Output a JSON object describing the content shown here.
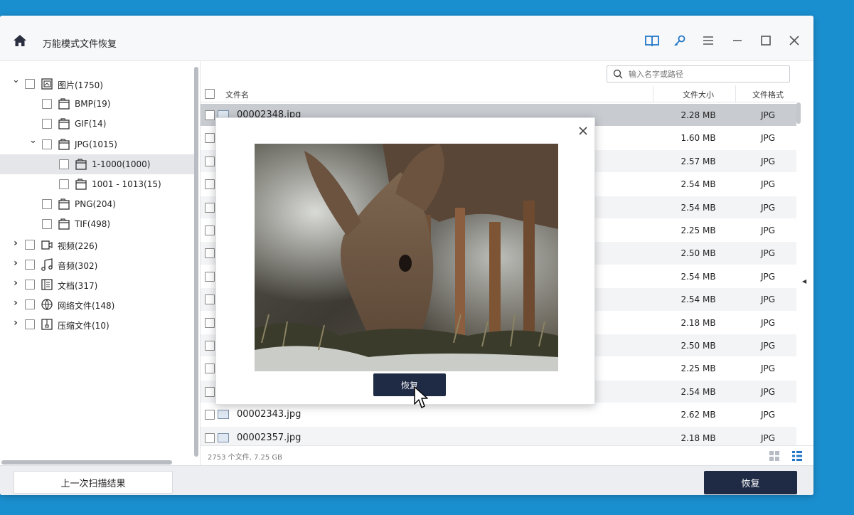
{
  "window": {
    "title": "万能模式文件恢复"
  },
  "search": {
    "placeholder": "输入名字或路径"
  },
  "tree": [
    {
      "label": "图片(1750)",
      "level": 0,
      "arrow": "down",
      "icon": "image-folder-icon"
    },
    {
      "label": "BMP(19)",
      "level": 1,
      "arrow": "",
      "icon": "folder-icon"
    },
    {
      "label": "GIF(14)",
      "level": 1,
      "arrow": "",
      "icon": "folder-icon"
    },
    {
      "label": "JPG(1015)",
      "level": 1,
      "arrow": "down",
      "icon": "folder-icon"
    },
    {
      "label": "1-1000(1000)",
      "level": 2,
      "arrow": "",
      "icon": "folder-icon",
      "selected": true
    },
    {
      "label": "1001 -  1013(15)",
      "level": 2,
      "arrow": "",
      "icon": "folder-icon"
    },
    {
      "label": "PNG(204)",
      "level": 1,
      "arrow": "",
      "icon": "folder-icon"
    },
    {
      "label": "TIF(498)",
      "level": 1,
      "arrow": "",
      "icon": "folder-icon"
    },
    {
      "label": "视频(226)",
      "level": 0,
      "arrow": "right",
      "icon": "video-icon"
    },
    {
      "label": "音频(302)",
      "level": 0,
      "arrow": "right",
      "icon": "music-icon"
    },
    {
      "label": "文档(317)",
      "level": 0,
      "arrow": "right",
      "icon": "document-icon"
    },
    {
      "label": "网络文件(148)",
      "level": 0,
      "arrow": "right",
      "icon": "globe-icon"
    },
    {
      "label": "压缩文件(10)",
      "level": 0,
      "arrow": "right",
      "icon": "archive-icon"
    }
  ],
  "table": {
    "columns": {
      "name": "文件名",
      "size": "文件大小",
      "type": "文件格式"
    },
    "rows": [
      {
        "name": "00002348.jpg",
        "size": "2.28 MB",
        "type": "JPG",
        "selected": true
      },
      {
        "name": "",
        "size": "1.60 MB",
        "type": "JPG"
      },
      {
        "name": "",
        "size": "2.57 MB",
        "type": "JPG"
      },
      {
        "name": "",
        "size": "2.54 MB",
        "type": "JPG"
      },
      {
        "name": "",
        "size": "2.54 MB",
        "type": "JPG"
      },
      {
        "name": "",
        "size": "2.25 MB",
        "type": "JPG"
      },
      {
        "name": "",
        "size": "2.50 MB",
        "type": "JPG"
      },
      {
        "name": "",
        "size": "2.54 MB",
        "type": "JPG"
      },
      {
        "name": "",
        "size": "2.54 MB",
        "type": "JPG"
      },
      {
        "name": "",
        "size": "2.18 MB",
        "type": "JPG"
      },
      {
        "name": "",
        "size": "2.50 MB",
        "type": "JPG"
      },
      {
        "name": "",
        "size": "2.25 MB",
        "type": "JPG"
      },
      {
        "name": "",
        "size": "2.54 MB",
        "type": "JPG"
      },
      {
        "name": "00002343.jpg",
        "size": "2.62 MB",
        "type": "JPG"
      },
      {
        "name": "00002357.jpg",
        "size": "2.18 MB",
        "type": "JPG"
      }
    ]
  },
  "status": {
    "summary": "2753 个文件, 7.25 GB"
  },
  "buttons": {
    "prev_scan": "上一次扫描结果",
    "recover": "恢复"
  },
  "modal": {
    "recover": "恢复"
  },
  "colors": {
    "accent": "#1a8fd0",
    "dark_button": "#1f2b45",
    "icon_blue": "#2176c7"
  }
}
